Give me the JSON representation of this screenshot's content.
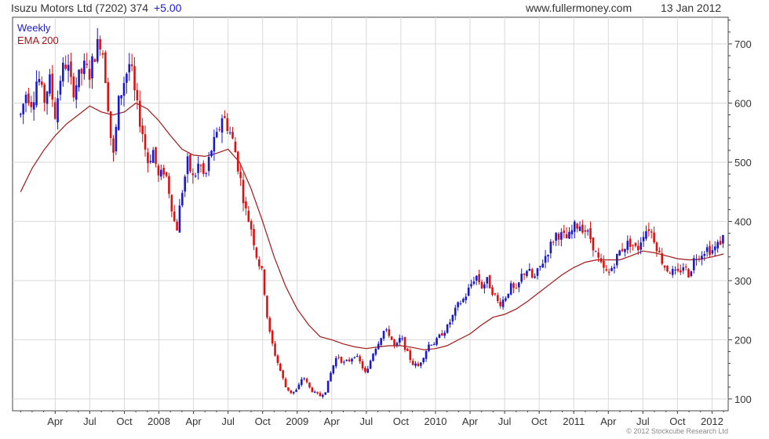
{
  "header": {
    "title": "Isuzu Motors Ltd (7202) 374",
    "change": "+5.00",
    "site": "www.fullermoney.com",
    "date": "13 Jan 2012"
  },
  "legend": {
    "weekly": "Weekly",
    "ema": "EMA 200"
  },
  "credit": "© 2012 Stockcube Research Ltd",
  "colors": {
    "up": "#1a1acc",
    "down": "#e01010",
    "ema": "#a01818",
    "grid": "#d9d9d9",
    "change": "#1a1acc"
  },
  "chart_data": {
    "type": "candlestick",
    "title": "Isuzu Motors Ltd (7202) 374 +5.00",
    "frequency": "Weekly",
    "ylim": [
      80,
      745
    ],
    "yticks": [
      100,
      200,
      300,
      400,
      500,
      600,
      700
    ],
    "xlim": [
      0,
      52
    ],
    "xticks": [
      {
        "t": 3,
        "label": "Apr"
      },
      {
        "t": 6,
        "label": "Jul"
      },
      {
        "t": 9,
        "label": "Oct"
      },
      {
        "t": 12,
        "label": "2008"
      },
      {
        "t": 15,
        "label": "Apr"
      },
      {
        "t": 18,
        "label": "Jul"
      },
      {
        "t": 21,
        "label": "Oct"
      },
      {
        "t": 24,
        "label": "2009"
      },
      {
        "t": 27,
        "label": "Apr"
      },
      {
        "t": 30,
        "label": "Jul"
      },
      {
        "t": 33,
        "label": "Oct"
      },
      {
        "t": 36,
        "label": "2010"
      },
      {
        "t": 39,
        "label": "Apr"
      },
      {
        "t": 42,
        "label": "Jul"
      },
      {
        "t": 45,
        "label": "Oct"
      },
      {
        "t": 48,
        "label": "2011"
      },
      {
        "t": 51,
        "label": "Apr"
      },
      {
        "t": 54,
        "label": "Jul"
      },
      {
        "t": 57,
        "label": "Oct"
      },
      {
        "t": 60,
        "label": "2012"
      }
    ],
    "price_path": [
      [
        0.0,
        580
      ],
      [
        0.5,
        620
      ],
      [
        1.0,
        600
      ],
      [
        1.5,
        650
      ],
      [
        2.0,
        600
      ],
      [
        2.5,
        640
      ],
      [
        3.0,
        580
      ],
      [
        3.5,
        650
      ],
      [
        4.0,
        670
      ],
      [
        4.5,
        620
      ],
      [
        5.0,
        640
      ],
      [
        5.5,
        660
      ],
      [
        6.0,
        650
      ],
      [
        6.5,
        690
      ],
      [
        7.0,
        710
      ],
      [
        7.5,
        620
      ],
      [
        8.0,
        500
      ],
      [
        8.5,
        600
      ],
      [
        9.0,
        640
      ],
      [
        9.5,
        670
      ],
      [
        10.0,
        600
      ],
      [
        10.5,
        560
      ],
      [
        11.0,
        500
      ],
      [
        11.5,
        520
      ],
      [
        12.0,
        470
      ],
      [
        12.5,
        490
      ],
      [
        13.0,
        440
      ],
      [
        13.5,
        380
      ],
      [
        14.0,
        450
      ],
      [
        14.5,
        500
      ],
      [
        15.0,
        470
      ],
      [
        15.5,
        500
      ],
      [
        16.0,
        470
      ],
      [
        16.5,
        520
      ],
      [
        17.0,
        540
      ],
      [
        17.5,
        580
      ],
      [
        18.0,
        560
      ],
      [
        18.5,
        530
      ],
      [
        19.0,
        480
      ],
      [
        19.5,
        420
      ],
      [
        20.0,
        390
      ],
      [
        20.5,
        340
      ],
      [
        21.0,
        310
      ],
      [
        21.5,
        220
      ],
      [
        22.0,
        180
      ],
      [
        22.5,
        150
      ],
      [
        23.0,
        120
      ],
      [
        23.5,
        110
      ],
      [
        24.0,
        115
      ],
      [
        24.5,
        140
      ],
      [
        25.0,
        120
      ],
      [
        25.5,
        110
      ],
      [
        26.0,
        105
      ],
      [
        26.5,
        115
      ],
      [
        27.0,
        150
      ],
      [
        27.5,
        175
      ],
      [
        28.0,
        160
      ],
      [
        28.5,
        165
      ],
      [
        29.0,
        175
      ],
      [
        29.5,
        160
      ],
      [
        30.0,
        140
      ],
      [
        30.5,
        175
      ],
      [
        31.0,
        195
      ],
      [
        31.5,
        215
      ],
      [
        32.0,
        210
      ],
      [
        32.5,
        185
      ],
      [
        33.0,
        205
      ],
      [
        33.5,
        180
      ],
      [
        34.0,
        160
      ],
      [
        34.5,
        155
      ],
      [
        35.0,
        175
      ],
      [
        35.5,
        195
      ],
      [
        36.0,
        195
      ],
      [
        36.5,
        210
      ],
      [
        37.0,
        220
      ],
      [
        37.5,
        240
      ],
      [
        38.0,
        260
      ],
      [
        38.5,
        270
      ],
      [
        39.0,
        290
      ],
      [
        39.5,
        310
      ],
      [
        40.0,
        290
      ],
      [
        40.5,
        300
      ],
      [
        41.0,
        280
      ],
      [
        41.5,
        260
      ],
      [
        42.0,
        270
      ],
      [
        42.5,
        290
      ],
      [
        43.0,
        280
      ],
      [
        43.5,
        310
      ],
      [
        44.0,
        320
      ],
      [
        44.5,
        300
      ],
      [
        45.0,
        320
      ],
      [
        45.5,
        340
      ],
      [
        46.0,
        360
      ],
      [
        46.5,
        380
      ],
      [
        47.0,
        375
      ],
      [
        47.5,
        370
      ],
      [
        48.0,
        390
      ],
      [
        48.5,
        395
      ],
      [
        49.0,
        385
      ],
      [
        49.5,
        370
      ],
      [
        50.0,
        340
      ],
      [
        50.5,
        320
      ],
      [
        51.0,
        310
      ],
      [
        51.5,
        330
      ],
      [
        52.0,
        350
      ],
      [
        52.5,
        360
      ],
      [
        53.0,
        365
      ],
      [
        53.5,
        350
      ],
      [
        54.0,
        380
      ],
      [
        54.5,
        390
      ],
      [
        55.0,
        370
      ],
      [
        55.5,
        340
      ],
      [
        56.0,
        320
      ],
      [
        56.5,
        315
      ],
      [
        57.0,
        310
      ],
      [
        57.5,
        325
      ],
      [
        58.0,
        310
      ],
      [
        58.5,
        340
      ],
      [
        59.0,
        345
      ],
      [
        59.5,
        355
      ],
      [
        60.0,
        350
      ],
      [
        60.5,
        360
      ],
      [
        61.0,
        374
      ]
    ],
    "ema_path": [
      [
        0.0,
        450
      ],
      [
        1.0,
        490
      ],
      [
        2.0,
        520
      ],
      [
        3.0,
        545
      ],
      [
        4.0,
        565
      ],
      [
        5.0,
        580
      ],
      [
        6.0,
        595
      ],
      [
        7.0,
        585
      ],
      [
        8.0,
        580
      ],
      [
        9.0,
        585
      ],
      [
        10.0,
        600
      ],
      [
        11.0,
        590
      ],
      [
        12.0,
        570
      ],
      [
        13.0,
        545
      ],
      [
        14.0,
        522
      ],
      [
        15.0,
        512
      ],
      [
        16.0,
        510
      ],
      [
        17.0,
        515
      ],
      [
        18.0,
        522
      ],
      [
        19.0,
        500
      ],
      [
        20.0,
        455
      ],
      [
        21.0,
        400
      ],
      [
        22.0,
        340
      ],
      [
        23.0,
        290
      ],
      [
        24.0,
        252
      ],
      [
        25.0,
        225
      ],
      [
        26.0,
        205
      ],
      [
        27.0,
        200
      ],
      [
        28.0,
        193
      ],
      [
        29.0,
        188
      ],
      [
        30.0,
        185
      ],
      [
        31.0,
        188
      ],
      [
        32.0,
        190
      ],
      [
        33.0,
        190
      ],
      [
        34.0,
        187
      ],
      [
        35.0,
        183
      ],
      [
        36.0,
        185
      ],
      [
        37.0,
        190
      ],
      [
        38.0,
        200
      ],
      [
        39.0,
        210
      ],
      [
        40.0,
        225
      ],
      [
        41.0,
        238
      ],
      [
        42.0,
        243
      ],
      [
        43.0,
        252
      ],
      [
        44.0,
        265
      ],
      [
        45.0,
        280
      ],
      [
        46.0,
        295
      ],
      [
        47.0,
        310
      ],
      [
        48.0,
        322
      ],
      [
        49.0,
        331
      ],
      [
        50.0,
        335
      ],
      [
        51.0,
        335
      ],
      [
        52.0,
        335
      ],
      [
        53.0,
        342
      ],
      [
        54.0,
        350
      ],
      [
        55.0,
        347
      ],
      [
        56.0,
        342
      ],
      [
        57.0,
        337
      ],
      [
        58.0,
        335
      ],
      [
        59.0,
        336
      ],
      [
        60.0,
        340
      ],
      [
        61.0,
        345
      ]
    ]
  }
}
